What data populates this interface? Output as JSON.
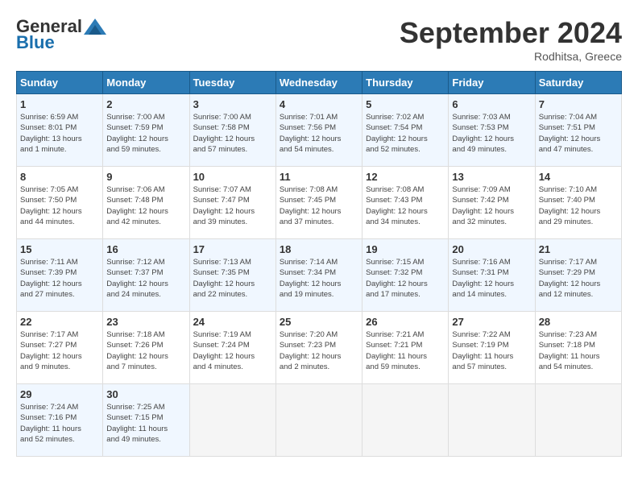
{
  "header": {
    "logo_general": "General",
    "logo_blue": "Blue",
    "title": "September 2024",
    "location": "Rodhitsa, Greece"
  },
  "days_of_week": [
    "Sunday",
    "Monday",
    "Tuesday",
    "Wednesday",
    "Thursday",
    "Friday",
    "Saturday"
  ],
  "weeks": [
    [
      {
        "day": "1",
        "info": "Sunrise: 6:59 AM\nSunset: 8:01 PM\nDaylight: 13 hours\nand 1 minute."
      },
      {
        "day": "2",
        "info": "Sunrise: 7:00 AM\nSunset: 7:59 PM\nDaylight: 12 hours\nand 59 minutes."
      },
      {
        "day": "3",
        "info": "Sunrise: 7:00 AM\nSunset: 7:58 PM\nDaylight: 12 hours\nand 57 minutes."
      },
      {
        "day": "4",
        "info": "Sunrise: 7:01 AM\nSunset: 7:56 PM\nDaylight: 12 hours\nand 54 minutes."
      },
      {
        "day": "5",
        "info": "Sunrise: 7:02 AM\nSunset: 7:54 PM\nDaylight: 12 hours\nand 52 minutes."
      },
      {
        "day": "6",
        "info": "Sunrise: 7:03 AM\nSunset: 7:53 PM\nDaylight: 12 hours\nand 49 minutes."
      },
      {
        "day": "7",
        "info": "Sunrise: 7:04 AM\nSunset: 7:51 PM\nDaylight: 12 hours\nand 47 minutes."
      }
    ],
    [
      {
        "day": "8",
        "info": "Sunrise: 7:05 AM\nSunset: 7:50 PM\nDaylight: 12 hours\nand 44 minutes."
      },
      {
        "day": "9",
        "info": "Sunrise: 7:06 AM\nSunset: 7:48 PM\nDaylight: 12 hours\nand 42 minutes."
      },
      {
        "day": "10",
        "info": "Sunrise: 7:07 AM\nSunset: 7:47 PM\nDaylight: 12 hours\nand 39 minutes."
      },
      {
        "day": "11",
        "info": "Sunrise: 7:08 AM\nSunset: 7:45 PM\nDaylight: 12 hours\nand 37 minutes."
      },
      {
        "day": "12",
        "info": "Sunrise: 7:08 AM\nSunset: 7:43 PM\nDaylight: 12 hours\nand 34 minutes."
      },
      {
        "day": "13",
        "info": "Sunrise: 7:09 AM\nSunset: 7:42 PM\nDaylight: 12 hours\nand 32 minutes."
      },
      {
        "day": "14",
        "info": "Sunrise: 7:10 AM\nSunset: 7:40 PM\nDaylight: 12 hours\nand 29 minutes."
      }
    ],
    [
      {
        "day": "15",
        "info": "Sunrise: 7:11 AM\nSunset: 7:39 PM\nDaylight: 12 hours\nand 27 minutes."
      },
      {
        "day": "16",
        "info": "Sunrise: 7:12 AM\nSunset: 7:37 PM\nDaylight: 12 hours\nand 24 minutes."
      },
      {
        "day": "17",
        "info": "Sunrise: 7:13 AM\nSunset: 7:35 PM\nDaylight: 12 hours\nand 22 minutes."
      },
      {
        "day": "18",
        "info": "Sunrise: 7:14 AM\nSunset: 7:34 PM\nDaylight: 12 hours\nand 19 minutes."
      },
      {
        "day": "19",
        "info": "Sunrise: 7:15 AM\nSunset: 7:32 PM\nDaylight: 12 hours\nand 17 minutes."
      },
      {
        "day": "20",
        "info": "Sunrise: 7:16 AM\nSunset: 7:31 PM\nDaylight: 12 hours\nand 14 minutes."
      },
      {
        "day": "21",
        "info": "Sunrise: 7:17 AM\nSunset: 7:29 PM\nDaylight: 12 hours\nand 12 minutes."
      }
    ],
    [
      {
        "day": "22",
        "info": "Sunrise: 7:17 AM\nSunset: 7:27 PM\nDaylight: 12 hours\nand 9 minutes."
      },
      {
        "day": "23",
        "info": "Sunrise: 7:18 AM\nSunset: 7:26 PM\nDaylight: 12 hours\nand 7 minutes."
      },
      {
        "day": "24",
        "info": "Sunrise: 7:19 AM\nSunset: 7:24 PM\nDaylight: 12 hours\nand 4 minutes."
      },
      {
        "day": "25",
        "info": "Sunrise: 7:20 AM\nSunset: 7:23 PM\nDaylight: 12 hours\nand 2 minutes."
      },
      {
        "day": "26",
        "info": "Sunrise: 7:21 AM\nSunset: 7:21 PM\nDaylight: 11 hours\nand 59 minutes."
      },
      {
        "day": "27",
        "info": "Sunrise: 7:22 AM\nSunset: 7:19 PM\nDaylight: 11 hours\nand 57 minutes."
      },
      {
        "day": "28",
        "info": "Sunrise: 7:23 AM\nSunset: 7:18 PM\nDaylight: 11 hours\nand 54 minutes."
      }
    ],
    [
      {
        "day": "29",
        "info": "Sunrise: 7:24 AM\nSunset: 7:16 PM\nDaylight: 11 hours\nand 52 minutes."
      },
      {
        "day": "30",
        "info": "Sunrise: 7:25 AM\nSunset: 7:15 PM\nDaylight: 11 hours\nand 49 minutes."
      },
      {
        "day": "",
        "info": ""
      },
      {
        "day": "",
        "info": ""
      },
      {
        "day": "",
        "info": ""
      },
      {
        "day": "",
        "info": ""
      },
      {
        "day": "",
        "info": ""
      }
    ]
  ]
}
